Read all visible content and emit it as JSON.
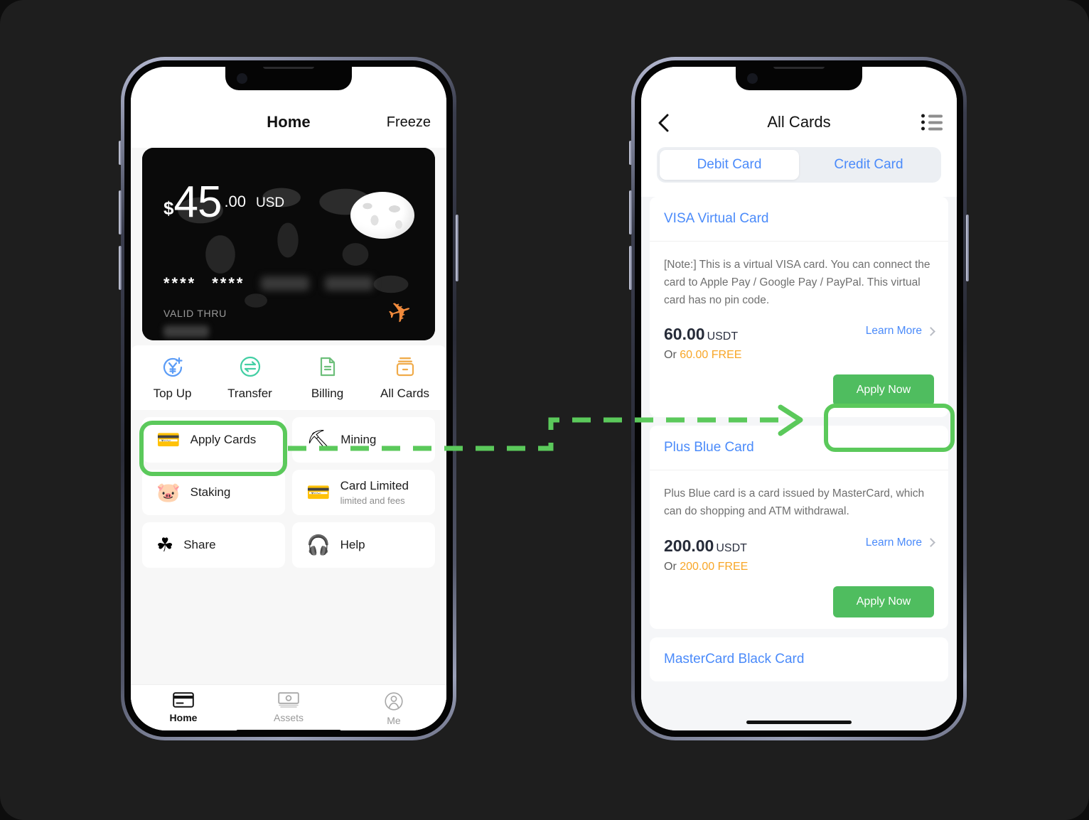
{
  "theme": {
    "background": "#1e1e1e",
    "accent_green": "#5bc95b",
    "button_green": "#4fbd5f",
    "link_blue": "#4b8bfa",
    "free_orange": "#f8a627"
  },
  "left_phone": {
    "header": {
      "title": "Home",
      "action": "Freeze"
    },
    "balance_card": {
      "currency_symbol": "$",
      "amount_integer": "45",
      "amount_decimal": ".00",
      "currency_code": "USD",
      "masked_groups": [
        "****",
        "****"
      ],
      "valid_thru_label": "VALID THRU",
      "plane_icon": "airplane-icon",
      "globe_icon": "globe-icon"
    },
    "quick_actions": [
      {
        "label": "Top Up",
        "icon": "top-up-icon"
      },
      {
        "label": "Transfer",
        "icon": "transfer-icon"
      },
      {
        "label": "Billing",
        "icon": "billing-icon"
      },
      {
        "label": "All Cards",
        "icon": "all-cards-icon"
      }
    ],
    "tiles": [
      {
        "label": "Apply Cards",
        "sub": "",
        "emoji": "💳",
        "highlighted": true
      },
      {
        "label": "Mining",
        "sub": "",
        "emoji": "⛏️",
        "highlighted": false
      },
      {
        "label": "Staking",
        "sub": "",
        "emoji": "🐖",
        "highlighted": false
      },
      {
        "label": "Card Limited",
        "sub": "limited and fees",
        "emoji": "💳",
        "highlighted": false
      },
      {
        "label": "Share",
        "sub": "",
        "emoji": "☘",
        "highlighted": false
      },
      {
        "label": "Help",
        "sub": "",
        "emoji": "🎧",
        "highlighted": false
      }
    ],
    "tabbar": [
      {
        "label": "Home",
        "icon": "card-icon",
        "active": true
      },
      {
        "label": "Assets",
        "icon": "cash-icon",
        "active": false
      },
      {
        "label": "Me",
        "icon": "person-icon",
        "active": false
      }
    ]
  },
  "right_phone": {
    "header": {
      "title": "All Cards",
      "back_icon": "back-chevron-icon",
      "menu_icon": "list-icon"
    },
    "segments": [
      {
        "label": "Debit Card",
        "active": true
      },
      {
        "label": "Credit Card",
        "active": false
      }
    ],
    "cards": [
      {
        "name": "VISA Virtual Card",
        "note": "[Note:] This is a virtual VISA card. You can connect the card to Apple Pay / Google Pay / PayPal. This virtual card has no pin code.",
        "price": "60.00",
        "unit": "USDT",
        "free_prefix": "Or",
        "free_amount": "60.00",
        "free_suffix": "FREE",
        "learn_more": "Learn More",
        "apply_label": "Apply Now",
        "highlighted": true
      },
      {
        "name": "Plus Blue Card",
        "note": "Plus Blue card is a card issued by MasterCard, which can do shopping and ATM withdrawal.",
        "price": "200.00",
        "unit": "USDT",
        "free_prefix": "Or",
        "free_amount": "200.00",
        "free_suffix": "FREE",
        "learn_more": "Learn More",
        "apply_label": "Apply Now",
        "highlighted": false
      },
      {
        "name": "MasterCard Black Card",
        "note": "",
        "price": "",
        "unit": "",
        "free_prefix": "",
        "free_amount": "",
        "free_suffix": "",
        "learn_more": "",
        "apply_label": "",
        "highlighted": false
      }
    ]
  },
  "annotation": {
    "arrow_icon": "dashed-arrow-right",
    "highlight_source": "Apply Cards",
    "highlight_target": "Apply Now"
  }
}
